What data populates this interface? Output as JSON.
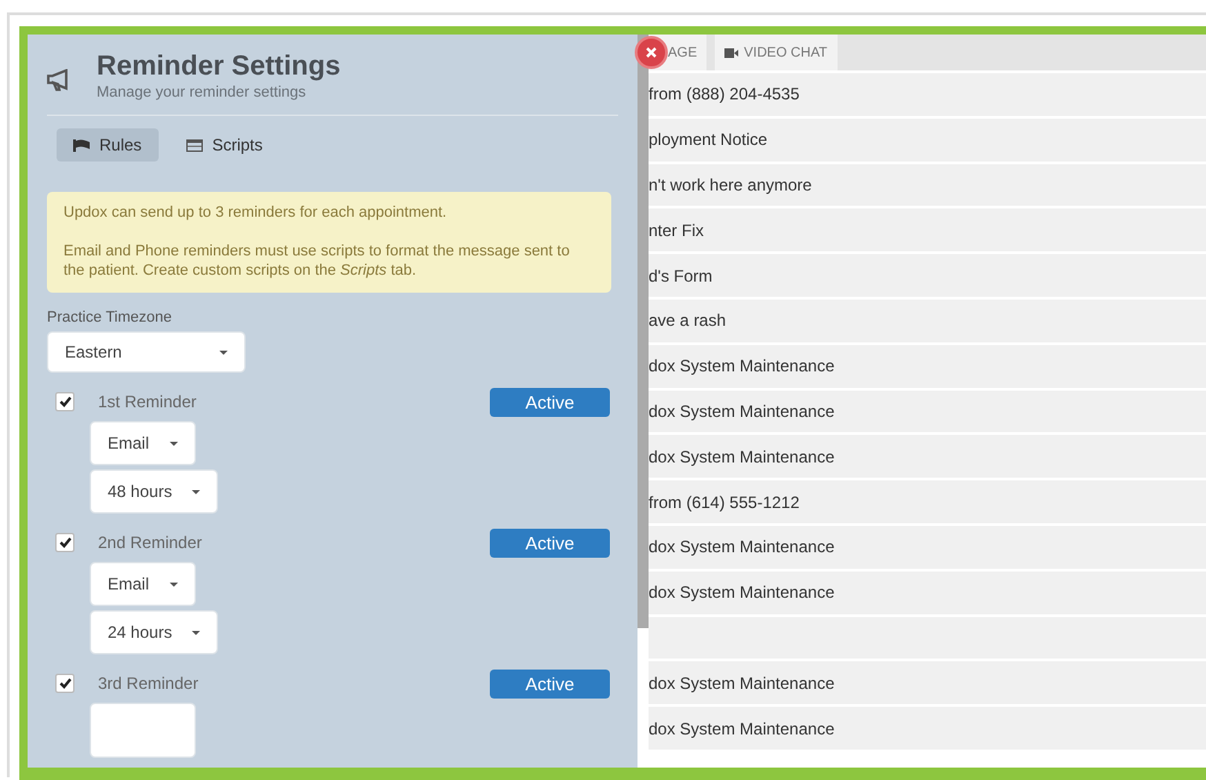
{
  "panel": {
    "title": "Reminder Settings",
    "subtitle": "Manage your reminder settings",
    "tabs": [
      {
        "label": "Rules",
        "selected": true
      },
      {
        "label": "Scripts",
        "selected": false
      }
    ],
    "notice": [
      "Updox can send up to 3 reminders for each appointment.",
      "Email and Phone reminders must use scripts to format the message sent to the patient. Create custom scripts on the *Scripts* tab."
    ],
    "timezone": {
      "label": "Practice Timezone",
      "value": "Eastern"
    },
    "reminders": [
      {
        "label": "1st Reminder",
        "checked": true,
        "status": "Active",
        "selects": [
          {
            "kind": "select",
            "value": "Email"
          },
          {
            "kind": "select",
            "value": "48 hours"
          }
        ]
      },
      {
        "label": "2nd Reminder",
        "checked": true,
        "status": "Active",
        "selects": [
          {
            "kind": "select",
            "value": "Email"
          },
          {
            "kind": "select",
            "value": "24 hours"
          }
        ]
      },
      {
        "label": "3rd Reminder",
        "checked": true,
        "status": "Active",
        "selects": [
          {
            "kind": "cut-off"
          }
        ]
      }
    ]
  },
  "toolbar": {
    "buttons": [
      {
        "label": "AGE"
      },
      {
        "label": "VIDEO CHAT"
      }
    ]
  },
  "messages": [
    {
      "kind": "message",
      "subject": "from (888) 204-4535"
    },
    {
      "kind": "message",
      "subject": "ployment Notice"
    },
    {
      "kind": "message",
      "subject": "n't work here anymore"
    },
    {
      "kind": "message",
      "subject": "nter Fix"
    },
    {
      "kind": "message",
      "subject": "d's Form"
    },
    {
      "kind": "message",
      "subject": "ave a rash"
    },
    {
      "kind": "message",
      "subject": "dox System Maintenance"
    },
    {
      "kind": "message",
      "subject": "dox System Maintenance"
    },
    {
      "kind": "message",
      "subject": "dox System Maintenance"
    },
    {
      "kind": "message",
      "subject": "from (614) 555-1212"
    },
    {
      "kind": "message",
      "subject": "dox System Maintenance"
    },
    {
      "kind": "message",
      "subject": "dox System Maintenance"
    },
    {
      "kind": "empty"
    },
    {
      "kind": "message",
      "subject": "dox System Maintenance"
    },
    {
      "kind": "message",
      "subject": "dox System Maintenance"
    }
  ]
}
